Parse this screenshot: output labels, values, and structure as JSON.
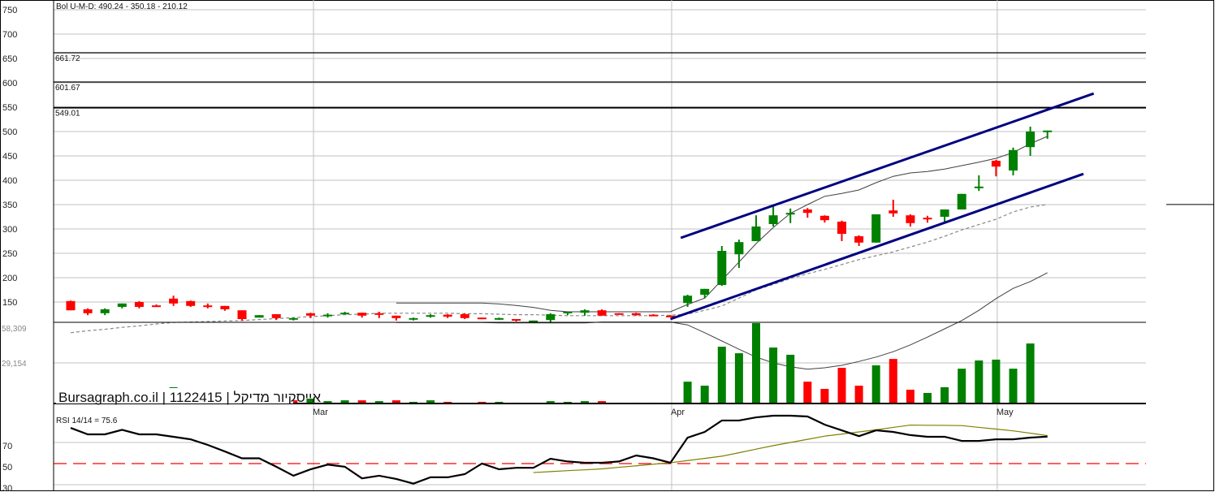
{
  "watermark": "Bursagraph.co.il | 1122415 | אייסקיור מדיקל",
  "colors": {
    "up": "#008000",
    "down": "#ff0000",
    "channel": "#000080",
    "grid": "#c0c0c0",
    "rsi_ma": "#808000",
    "rsi_ref": "#ff0000",
    "band": "#404040",
    "mid": "#888888"
  },
  "chart_data": [
    {
      "type": "candlestick",
      "title": "Bol U-M-D: 490.24 - 350.18 - 210.12",
      "ylim": [
        150,
        750
      ],
      "yticks": [
        750,
        700,
        650,
        600,
        550,
        500,
        450,
        400,
        350,
        300,
        250,
        200,
        150
      ],
      "x_labels": [
        {
          "label": "Mar",
          "index": 14.17
        },
        {
          "label": "Apr",
          "index": 35.07
        },
        {
          "label": "May",
          "index": 54.07
        }
      ],
      "levels": [
        {
          "value": 661.72,
          "label": "661.72"
        },
        {
          "value": 601.67,
          "label": "601.67"
        },
        {
          "value": 549.01,
          "label": "549.01"
        }
      ],
      "channels": [
        {
          "from": {
            "index": 35.6,
            "price": 281.7
          },
          "to": {
            "index": 59.7,
            "price": 578
          }
        },
        {
          "from": {
            "index": 35.0,
            "price": 115
          },
          "to": {
            "index": 59.1,
            "price": 413
          }
        }
      ],
      "last_marker": 350.18,
      "candles": [
        [
          152,
          153,
          133,
          133
        ],
        [
          135,
          137,
          123,
          127
        ],
        [
          127,
          137,
          123,
          135
        ],
        [
          140,
          147,
          137,
          147
        ],
        [
          150,
          152,
          137,
          140
        ],
        [
          143,
          145,
          142,
          142
        ],
        [
          157,
          163,
          142,
          147
        ],
        [
          152,
          153,
          140,
          142
        ],
        [
          143,
          147,
          137,
          142
        ],
        [
          142,
          142,
          132,
          135
        ],
        [
          133,
          133,
          112,
          115
        ],
        [
          118,
          123,
          118,
          123
        ],
        [
          125,
          125,
          113,
          117
        ],
        [
          115,
          118,
          112,
          117
        ],
        [
          127,
          128,
          117,
          122
        ],
        [
          122,
          127,
          118,
          124
        ],
        [
          125,
          130,
          125,
          128
        ],
        [
          128,
          128,
          118,
          122
        ],
        [
          127,
          130,
          117,
          125
        ],
        [
          122,
          122,
          112,
          117
        ],
        [
          115,
          118,
          112,
          117
        ],
        [
          120,
          125,
          118,
          123
        ],
        [
          124,
          125,
          117,
          120
        ],
        [
          125,
          127,
          115,
          117
        ],
        [
          118,
          118,
          115,
          115
        ],
        [
          115,
          118,
          113,
          117
        ],
        [
          115,
          115,
          110,
          112
        ],
        [
          110,
          112,
          108,
          112
        ],
        [
          113,
          127,
          108,
          125
        ],
        [
          127,
          130,
          123,
          130
        ],
        [
          128,
          135,
          122,
          133
        ],
        [
          133,
          135,
          122,
          122
        ],
        [
          127,
          127,
          125,
          126
        ],
        [
          127,
          128,
          122,
          123
        ],
        [
          124,
          125,
          122,
          122
        ],
        [
          122,
          123,
          119,
          120
        ],
        [
          148,
          165,
          140,
          163
        ],
        [
          165,
          177,
          158,
          177
        ],
        [
          185,
          265,
          183,
          255
        ],
        [
          248,
          278,
          220,
          273
        ],
        [
          275,
          328,
          275,
          305
        ],
        [
          310,
          347,
          305,
          328
        ],
        [
          330,
          342,
          312,
          333
        ],
        [
          340,
          343,
          323,
          333
        ],
        [
          327,
          328,
          313,
          318
        ],
        [
          315,
          317,
          275,
          290
        ],
        [
          285,
          287,
          265,
          272
        ],
        [
          272,
          330,
          272,
          330
        ],
        [
          338,
          360,
          325,
          332
        ],
        [
          328,
          330,
          305,
          312
        ],
        [
          323,
          327,
          313,
          322
        ],
        [
          325,
          340,
          313,
          340
        ],
        [
          340,
          372,
          340,
          372
        ],
        [
          385,
          410,
          378,
          387
        ],
        [
          440,
          442,
          408,
          428
        ],
        [
          420,
          467,
          410,
          462
        ],
        [
          468,
          510,
          450,
          500
        ],
        [
          500,
          502,
          485,
          502
        ]
      ],
      "bands": {
        "upper": [
          null,
          null,
          null,
          null,
          null,
          null,
          null,
          null,
          null,
          null,
          null,
          null,
          null,
          null,
          null,
          null,
          null,
          null,
          null,
          148,
          148,
          148,
          148,
          148,
          148,
          146,
          143,
          139,
          133,
          130,
          130,
          130,
          130,
          130,
          130,
          130,
          145,
          158,
          195,
          232,
          270,
          303,
          332,
          350,
          367,
          373,
          380,
          395,
          408,
          415,
          418,
          423,
          430,
          437,
          445,
          457,
          475,
          490.24
        ],
        "middle": [
          87,
          91,
          94,
          98,
          101,
          105,
          108,
          109,
          110,
          111,
          112,
          114,
          116,
          118,
          120,
          122,
          124,
          125,
          127,
          127,
          127,
          127,
          127,
          126,
          126,
          125,
          124,
          124,
          123,
          122,
          122,
          122,
          122,
          122,
          122,
          123,
          125,
          133,
          142,
          158,
          175,
          186,
          198,
          208,
          217,
          227,
          237,
          245,
          253,
          263,
          273,
          285,
          298,
          309,
          320,
          335,
          345,
          350.18
        ],
        "lower": [
          null,
          null,
          null,
          null,
          null,
          null,
          null,
          null,
          null,
          null,
          null,
          null,
          null,
          null,
          null,
          null,
          null,
          null,
          null,
          108,
          108,
          108,
          108,
          108,
          108,
          107,
          107,
          107,
          107,
          107,
          107,
          109,
          109,
          109,
          109,
          109,
          103,
          87,
          70,
          53,
          37,
          25,
          17,
          12,
          15,
          20,
          28,
          37,
          48,
          62,
          78,
          95,
          112,
          133,
          157,
          178,
          192,
          210.12
        ]
      }
    },
    {
      "type": "bar",
      "title": "Volume",
      "yticks": [
        {
          "value": 58309,
          "label": "58,309"
        },
        {
          "value": 29154,
          "label": "29,154"
        }
      ],
      "ylim": [
        0,
        58309
      ],
      "values": [
        [
          1500,
          "r"
        ],
        [
          1500,
          "g"
        ],
        [
          1500,
          "g"
        ],
        [
          1500,
          "g"
        ],
        [
          1500,
          "r"
        ],
        [
          1500,
          "g"
        ],
        [
          11700,
          "g"
        ],
        [
          1500,
          "r"
        ],
        [
          1500,
          "g"
        ],
        [
          1500,
          "r"
        ],
        [
          1500,
          "r"
        ],
        [
          1500,
          "g"
        ],
        [
          1500,
          "r"
        ],
        [
          2300,
          "r"
        ],
        [
          3500,
          "g"
        ],
        [
          1700,
          "g"
        ],
        [
          2300,
          "g"
        ],
        [
          2300,
          "r"
        ],
        [
          1700,
          "g"
        ],
        [
          2300,
          "r"
        ],
        [
          1200,
          "g"
        ],
        [
          2300,
          "g"
        ],
        [
          1200,
          "r"
        ],
        [
          600,
          "r"
        ],
        [
          1200,
          "r"
        ],
        [
          1200,
          "g"
        ],
        [
          600,
          "r"
        ],
        [
          600,
          "g"
        ],
        [
          1700,
          "g"
        ],
        [
          1200,
          "g"
        ],
        [
          1700,
          "g"
        ],
        [
          1700,
          "r"
        ],
        [
          600,
          "g"
        ],
        [
          600,
          "r"
        ],
        [
          600,
          "r"
        ],
        [
          600,
          "g"
        ],
        [
          15700,
          "g"
        ],
        [
          12800,
          "g"
        ],
        [
          40800,
          "g"
        ],
        [
          36100,
          "g"
        ],
        [
          57700,
          "g"
        ],
        [
          40200,
          "g"
        ],
        [
          35000,
          "g"
        ],
        [
          15700,
          "r"
        ],
        [
          10500,
          "r"
        ],
        [
          25600,
          "r"
        ],
        [
          12800,
          "r"
        ],
        [
          27400,
          "g"
        ],
        [
          32000,
          "r"
        ],
        [
          9900,
          "r"
        ],
        [
          7600,
          "g"
        ],
        [
          11700,
          "g"
        ],
        [
          25000,
          "g"
        ],
        [
          30900,
          "g"
        ],
        [
          31500,
          "g"
        ],
        [
          25000,
          "g"
        ],
        [
          43100,
          "g"
        ],
        [
          600,
          "g"
        ]
      ]
    },
    {
      "type": "line",
      "title": "RSI 14/14 = 75.6",
      "yticks": [
        70,
        50,
        30
      ],
      "reference": 50,
      "series": [
        {
          "name": "RSI",
          "values": [
            83.8,
            77.7,
            77.7,
            82,
            77.7,
            77.7,
            75.4,
            73,
            67.7,
            61.5,
            55,
            55,
            47,
            38.5,
            44.6,
            49,
            47,
            36,
            38.5,
            35.4,
            31,
            37,
            37,
            40,
            50,
            44.6,
            46,
            46,
            54.6,
            52,
            50.8,
            50.8,
            52,
            57.7,
            55,
            50.8,
            74.6,
            80,
            90.8,
            90.8,
            93.8,
            95.4,
            95.4,
            94.6,
            86.9,
            81.5,
            76,
            81.5,
            80,
            77,
            75.4,
            75.4,
            71.5,
            71.5,
            73,
            73,
            74.6,
            75.6
          ]
        },
        {
          "name": "RSI MA",
          "values": [
            null,
            null,
            null,
            null,
            null,
            null,
            null,
            null,
            null,
            null,
            null,
            null,
            null,
            null,
            null,
            null,
            null,
            null,
            null,
            null,
            null,
            null,
            null,
            null,
            null,
            null,
            null,
            41.5,
            42.4,
            43.3,
            44.1,
            45,
            46.5,
            47.9,
            49.4,
            50.8,
            52.9,
            54.9,
            57,
            60.3,
            63.7,
            67,
            70,
            73,
            76,
            78,
            80,
            82,
            84.3,
            86.5,
            86.3,
            86.2,
            86,
            84.3,
            82.7,
            81,
            78.8,
            76.5
          ]
        }
      ]
    }
  ]
}
